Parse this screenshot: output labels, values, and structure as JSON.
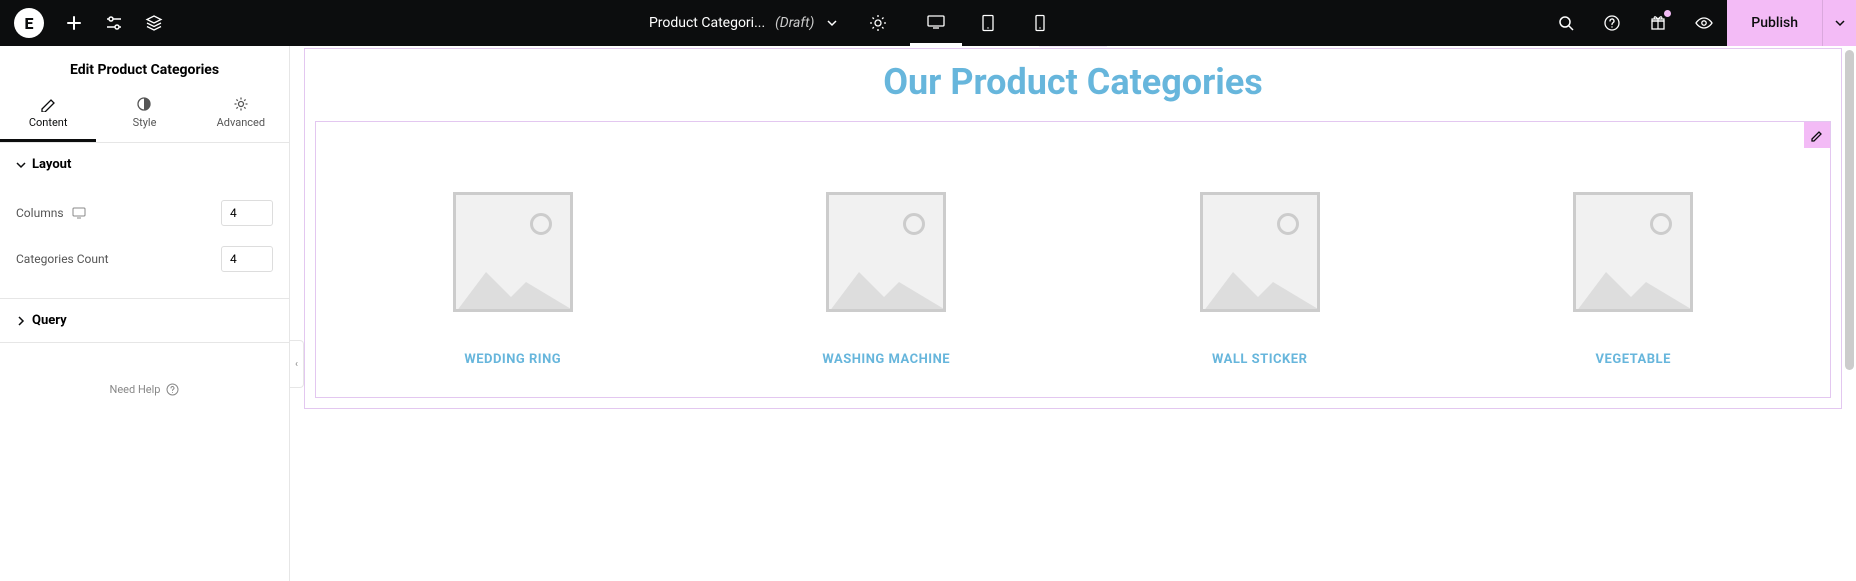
{
  "topbar": {
    "title": "Product Categori...",
    "draft": "(Draft)",
    "publish_label": "Publish"
  },
  "sidebar": {
    "header": "Edit Product Categories",
    "tabs": {
      "content": "Content",
      "style": "Style",
      "advanced": "Advanced"
    },
    "sections": {
      "layout": {
        "title": "Layout",
        "columns_label": "Columns",
        "columns_value": "4",
        "count_label": "Categories Count",
        "count_value": "4"
      },
      "query": {
        "title": "Query"
      }
    },
    "need_help": "Need Help"
  },
  "canvas": {
    "heading": "Our Product Categories",
    "categories": [
      "WEDDING RING",
      "WASHING MACHINE",
      "WALL STICKER",
      "VEGETABLE"
    ]
  },
  "colors": {
    "accent_blue": "#67b6dc",
    "accent_pink": "#f3bbf6",
    "outline": "#e3c7f0"
  }
}
